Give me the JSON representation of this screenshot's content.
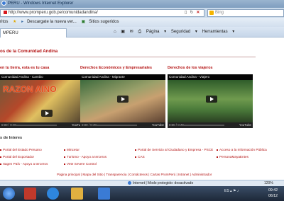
{
  "window": {
    "title": "PERU - Windows Internet Explorer"
  },
  "address": {
    "url": "http://www.promperu.gob.pe/comunidadandina/"
  },
  "search": {
    "engine": "Bing"
  },
  "favorites": {
    "label": "ritos",
    "items": [
      "Descargate la nueva ver...",
      "Sitios sugeridos"
    ]
  },
  "tab": {
    "label": "MPERU"
  },
  "commands": {
    "page": "Página",
    "security": "Seguridad",
    "tools": "Herramientas"
  },
  "page": {
    "heading": "os de la Comunidad Andina",
    "columns": [
      {
        "heading": "en tu tierra, esta es tu casa",
        "video_title": "Comunidad Andina - Cambio",
        "overlay": "RAZON AINO",
        "time": "0:00 / 0:49",
        "yt": "YouTube"
      },
      {
        "heading": "Derechos Económicos y Empresariales",
        "video_title": "Comunidad Andina - Migrante",
        "overlay": "",
        "time": "0:00 / 0:48",
        "yt": "YouTube"
      },
      {
        "heading": "Derechos de los viajeros",
        "video_title": "Comunidad Andina - Viajero",
        "overlay": "",
        "time": "0:00 / 0:48",
        "yt": "YouTube"
      }
    ],
    "sites_heading": "s de Interes",
    "links": [
      [
        "Portal del Estado Peruano",
        "Portal del Exportador",
        "rtagen País - Apoyo a terceros"
      ],
      [
        "Mincetur",
        "Turismo - Apoyo a terceros",
        "Vete Severe Control"
      ],
      [
        "Portal de Servicio al Ciudadano y Empresa - PSCE",
        "CAS"
      ],
      [
        "Acceso a la Información Pública",
        "PersonaMayaEntes"
      ]
    ],
    "footer": "Página principal  |  Mapa del Sitio  |  Transparencia  |  Contáctenos  |  Cartas PromPerú  |  Intranet  |  Administrador"
  },
  "statusbar": {
    "protected_mode": "Internet | Modo protegido: desactivado",
    "zoom": "120%"
  },
  "taskbar": {
    "lang": "ES",
    "time": "09:42",
    "date": "06/12"
  },
  "colors": {
    "accent_red": "#b41414",
    "ie_blue": "#3b7bd4"
  }
}
